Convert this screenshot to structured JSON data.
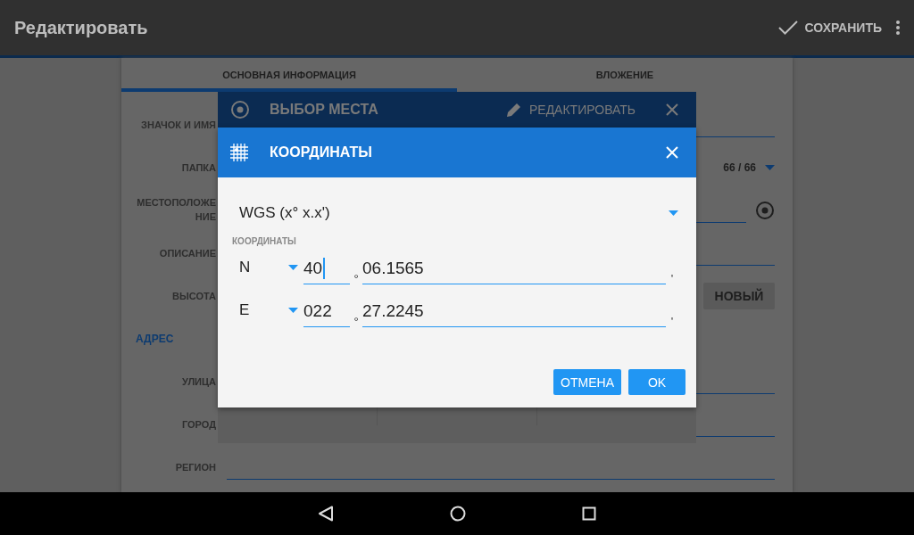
{
  "app_bar": {
    "title": "Редактировать",
    "save": "СОХРАНИТЬ"
  },
  "tabs": [
    {
      "label": "ОСНОВНАЯ ИНФОРМАЦИЯ",
      "selected": true
    },
    {
      "label": "ВЛОЖЕНИЕ",
      "selected": false
    }
  ],
  "form": [
    {
      "kind": "field",
      "label": "ЗНАЧОК И ИМЯ"
    },
    {
      "kind": "dropdown",
      "label": "ПАПКА",
      "value": "66 / 66"
    },
    {
      "kind": "location",
      "label": "МЕСТОПОЛОЖЕНИЕ"
    },
    {
      "kind": "field",
      "label": "ОПИСАНИЕ"
    },
    {
      "kind": "button",
      "label": "ВЫСОТА",
      "button": "НОВЫЙ"
    },
    {
      "kind": "section",
      "label": "АДРЕС"
    },
    {
      "kind": "field",
      "label": "УЛИЦА"
    },
    {
      "kind": "field",
      "label": "ГОРОД"
    },
    {
      "kind": "field",
      "label": "РЕГИОН"
    }
  ],
  "place_dialog": {
    "title": "ВЫБОР МЕСТА",
    "edit": "РЕДАКТИРОВАТЬ"
  },
  "coord_dialog": {
    "title": "КООРДИНАТЫ",
    "format": "WGS (x° x.x')",
    "section": "КООРДИНАТЫ",
    "rows": [
      {
        "hemisphere": "N",
        "degrees": "40",
        "degree_mark": "°",
        "minutes": "06.1565",
        "minute_mark": "'",
        "focused": true
      },
      {
        "hemisphere": "E",
        "degrees": "022",
        "degree_mark": "°",
        "minutes": "27.2245",
        "minute_mark": "'",
        "focused": false
      }
    ],
    "buttons": [
      "ОТМЕНА",
      "OK"
    ]
  }
}
